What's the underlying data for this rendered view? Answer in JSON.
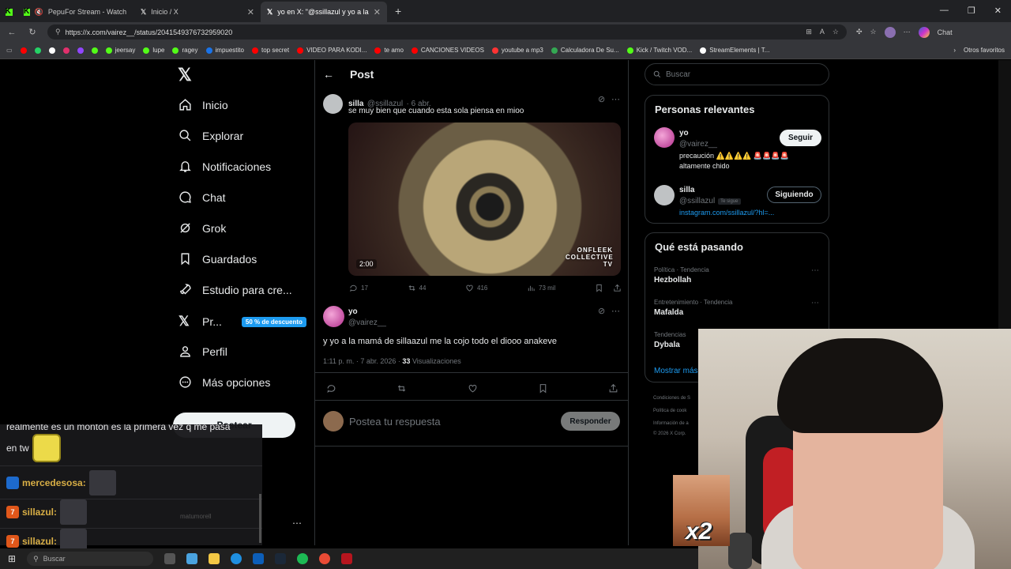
{
  "browser": {
    "tabs": [
      {
        "title": "PepuFor Stream - Watch Live",
        "icon": "kick-icon",
        "active": false
      },
      {
        "title": "Inicio / X",
        "icon": "x-icon",
        "active": false
      },
      {
        "title": "yo en X: \"@ssillazul y yo a la mam",
        "icon": "x-icon",
        "active": true
      }
    ],
    "new_tab": "+",
    "url": "https://x.com/vairez__/status/2041549376732959020",
    "chat_label": "Chat",
    "bookmarks": [
      {
        "label": "",
        "color": "#ff0000"
      },
      {
        "label": "",
        "color": "#25d366"
      },
      {
        "label": "",
        "color": "#ffffff"
      },
      {
        "label": "",
        "color": "#e1306c"
      },
      {
        "label": "",
        "color": "#9146ff"
      },
      {
        "label": "",
        "color": "#53fc18"
      },
      {
        "label": "jeersay",
        "color": "#53fc18"
      },
      {
        "label": "lupe",
        "color": "#53fc18"
      },
      {
        "label": "ragey",
        "color": "#53fc18"
      },
      {
        "label": "impuestito",
        "color": "#1a73e8"
      },
      {
        "label": "top secret",
        "color": "#ff0000"
      },
      {
        "label": "VIDEO PARA KODI...",
        "color": "#ff0000"
      },
      {
        "label": "te amo",
        "color": "#ff0000"
      },
      {
        "label": "CANCIONES VIDEOS",
        "color": "#ff0000"
      },
      {
        "label": "youtube a mp3",
        "color": "#ff3333"
      },
      {
        "label": "Calculadora De Su...",
        "color": "#34a853"
      },
      {
        "label": "Kick / Twitch VOD...",
        "color": "#53fc18"
      },
      {
        "label": "StreamElements | T...",
        "color": "#ffffff"
      }
    ],
    "other_bookmarks": "Otros favoritos"
  },
  "nav": {
    "items": [
      {
        "label": "Inicio",
        "icon": "home-icon"
      },
      {
        "label": "Explorar",
        "icon": "search-icon"
      },
      {
        "label": "Notificaciones",
        "icon": "bell-icon"
      },
      {
        "label": "Chat",
        "icon": "chat-icon"
      },
      {
        "label": "Grok",
        "icon": "grok-icon"
      },
      {
        "label": "Guardados",
        "icon": "bookmark-icon"
      },
      {
        "label": "Estudio para cre...",
        "icon": "rocket-icon"
      },
      {
        "label": "Pr...",
        "icon": "x-premium-icon"
      },
      {
        "label": "Perfil",
        "icon": "person-icon"
      },
      {
        "label": "Más opciones",
        "icon": "more-icon"
      }
    ],
    "promo_badge": "50 % de descuento",
    "post_button": "Postear"
  },
  "stream_chat": {
    "line1": "realmente es un monton es la primera vez q me pasa",
    "line2": "en tw",
    "messages": [
      {
        "user": "mercedesosa:"
      },
      {
        "user": "sillazul:"
      },
      {
        "user": "sillazul:"
      }
    ],
    "faded_user": "matumorell"
  },
  "post": {
    "header": "Post",
    "quoted": {
      "name": "silla",
      "handle": "@ssillazul",
      "date": "· 6 abr.",
      "text": "se muy bien que cuando esta sola piensa en mioo",
      "video_duration": "2:00",
      "watermark": "ONFLEEK COLLECTIVE TV",
      "replies": "17",
      "reposts": "44",
      "likes": "416",
      "views": "73 mil"
    },
    "main": {
      "name": "yo",
      "handle": "@vairez__",
      "text": "y yo a la mamá de sillaazul me la cojo todo el diooo anakeve",
      "time": "1:11 p. m. · 7 abr. 2026 ·",
      "views_count": "33",
      "views_label": "Visualizaciones"
    },
    "reply_placeholder": "Postea tu respuesta",
    "reply_button": "Responder"
  },
  "sidebar": {
    "search_placeholder": "Buscar",
    "relevant": {
      "title": "Personas relevantes",
      "people": [
        {
          "name": "yo",
          "handle": "@vairez__",
          "bio": "precaución ⚠️⚠️⚠️⚠️ 🚨🚨🚨🚨",
          "bio2": "altamente chido",
          "button": "Seguir",
          "follows_you": ""
        },
        {
          "name": "silla",
          "handle": "@ssillazul",
          "bio": "instagram.com/ssillazul/?hl=...",
          "bio2": "",
          "button": "Siguiendo",
          "follows_you": "Te sigue"
        }
      ]
    },
    "trends": {
      "title": "Qué está pasando",
      "items": [
        {
          "category": "Política · Tendencia",
          "name": "Hezbollah"
        },
        {
          "category": "Entretenimiento · Tendencia",
          "name": "Mafalda"
        },
        {
          "category": "Tendencias",
          "name": "Dybala"
        }
      ],
      "show_more": "Mostrar más"
    },
    "footer": [
      "Condiciones de S",
      "Política de cook",
      "Información de a",
      "© 2026 X Corp."
    ]
  },
  "overlay": {
    "meme_text": "x2"
  },
  "taskbar": {
    "search": "Buscar"
  }
}
